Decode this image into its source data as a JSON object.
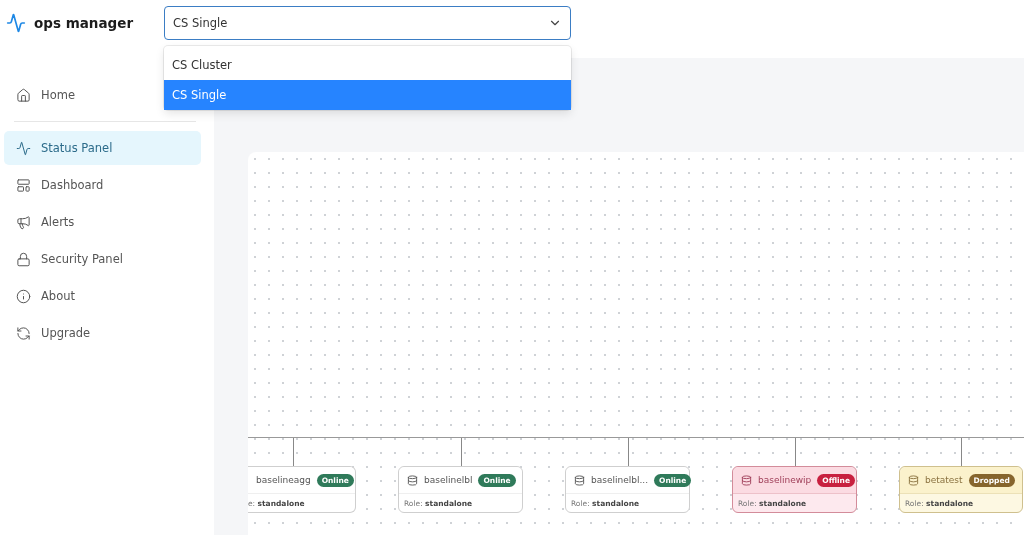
{
  "app": {
    "name": "ops manager"
  },
  "cluster_select": {
    "value": "CS Single",
    "expanded": true,
    "options": [
      {
        "label": "CS Cluster",
        "selected": false
      },
      {
        "label": "CS Single",
        "selected": true
      }
    ]
  },
  "sidebar": {
    "items": [
      {
        "label": "Home",
        "selected": false
      },
      {
        "label": "Status Panel",
        "selected": true
      },
      {
        "label": "Dashboard",
        "selected": false
      },
      {
        "label": "Alerts",
        "selected": false
      },
      {
        "label": "Security Panel",
        "selected": false
      },
      {
        "label": "About",
        "selected": false
      },
      {
        "label": "Upgrade",
        "selected": false
      }
    ]
  },
  "nodes": [
    {
      "name": "baselineagg",
      "kind": "online",
      "badge": "Online",
      "role": "e: **standalone**",
      "clipped": true
    },
    {
      "name": "baselinelbl",
      "kind": "online",
      "badge": "Online",
      "role": "Role: **standalone**",
      "clipped": false
    },
    {
      "name": "baselinelbl...",
      "kind": "online",
      "badge": "Online",
      "role": "Role: **standalone**",
      "clipped": false
    },
    {
      "name": "baselinewip",
      "kind": "offline",
      "badge": "Offline",
      "role": "Role: **standalone**",
      "clipped": false
    },
    {
      "name": "betatest",
      "kind": "dropped",
      "badge": "Dropped",
      "role": "Role: **standalone**",
      "clipped": false
    }
  ]
}
